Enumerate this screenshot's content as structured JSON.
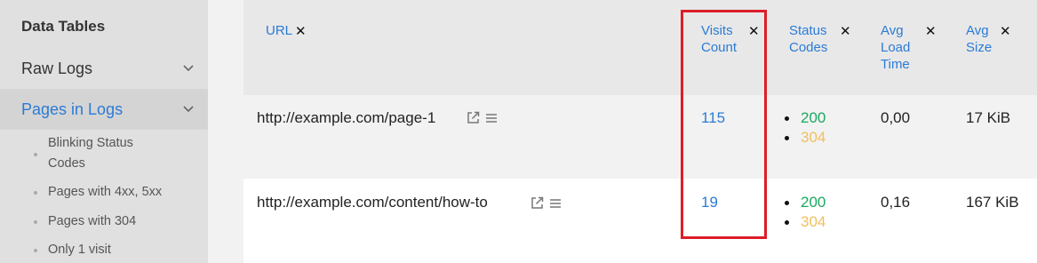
{
  "sidebar": {
    "title": "Data Tables",
    "items": [
      {
        "label": "Raw Logs"
      },
      {
        "label": "Pages in Logs"
      }
    ],
    "subitems": [
      {
        "label": "Blinking Status Codes"
      },
      {
        "label": "Pages with 4xx, 5xx"
      },
      {
        "label": "Pages with 304"
      },
      {
        "label": "Only 1 visit"
      }
    ]
  },
  "table": {
    "columns": [
      {
        "label": "URL"
      },
      {
        "label": "Visits Count"
      },
      {
        "label": "Status Codes"
      },
      {
        "label": "Avg Load Time"
      },
      {
        "label": "Avg Size"
      }
    ],
    "remove_glyph": "✕",
    "rows": [
      {
        "url": "http://example.com/page-1",
        "visits": "115",
        "codes": [
          "200",
          "304"
        ],
        "load": "0,00",
        "size": "17 KiB"
      },
      {
        "url": "http://example.com/content/how-to",
        "visits": "19",
        "codes": [
          "200",
          "304"
        ],
        "load": "0,16",
        "size": "167 KiB"
      }
    ]
  },
  "colors": {
    "accent": "#2b7bd6",
    "status_ok": "#1aa860",
    "status_not_modified": "#f0c060",
    "highlight": "#dc1e28"
  }
}
